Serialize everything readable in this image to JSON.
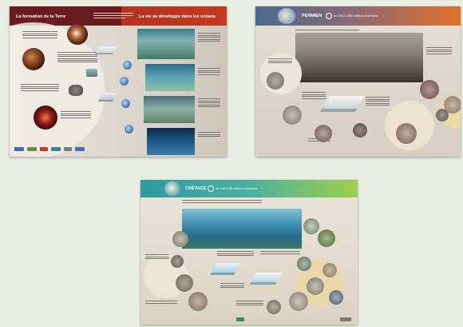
{
  "posters": [
    {
      "header_left": "La formation de la Terre",
      "header_right": "La vie se développe dans les océans",
      "colors": {
        "left_header": "#6b1a1f",
        "right_header": "#c43a22"
      }
    },
    {
      "period": "PERMIEN",
      "dates": "de 300 à 250 millions d'années",
      "colors": {
        "header_start": "#4a6a8d",
        "header_end": "#e0702a"
      }
    },
    {
      "period": "CRÉTACÉ",
      "dates": "de 145 à 65 millions d'années",
      "colors": {
        "header_start": "#2e9ba0",
        "header_end": "#9fcf4a"
      }
    }
  ]
}
